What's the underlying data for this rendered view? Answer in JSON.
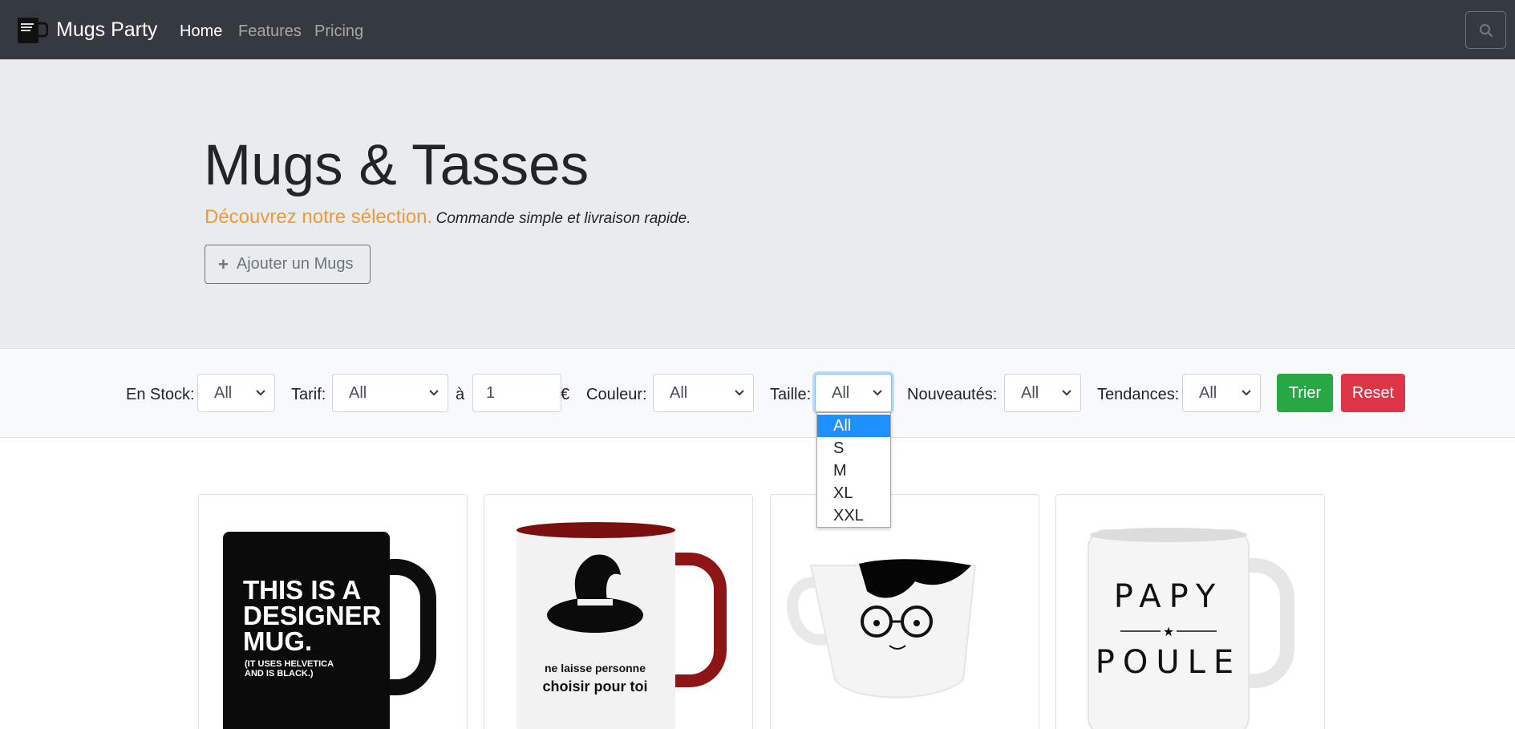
{
  "navbar": {
    "brand": "Mugs Party",
    "links": [
      "Home",
      "Features",
      "Pricing"
    ],
    "active_index": 0,
    "search_icon": "search-icon"
  },
  "hero": {
    "title": "Mugs & Tasses",
    "lead_accent": "Découvrez notre sélection.",
    "lead_sub": "Commande simple et livraison rapide.",
    "add_button": "Ajouter un Mugs",
    "add_icon": "plus-icon"
  },
  "filters": {
    "stock_label": "En Stock:",
    "stock_value": "All",
    "tarif_label": "Tarif:",
    "tarif_value": "All",
    "a_label": "à",
    "max_price_value": "1",
    "currency": "€",
    "couleur_label": "Couleur:",
    "couleur_value": "All",
    "taille_label": "Taille:",
    "taille_value": "All",
    "taille_options": [
      "All",
      "S",
      "M",
      "XL",
      "XXL"
    ],
    "taille_selected": "All",
    "nouveautes_label": "Nouveautés:",
    "nouveautes_value": "All",
    "tendances_label": "Tendances:",
    "tendances_value": "All",
    "sort_button": "Trier",
    "reset_button": "Reset"
  },
  "products": [
    {
      "image_text": [
        "THIS IS A",
        "DESIGNER",
        "MUG.",
        "(IT USES HELVETICA",
        "AND IS BLACK.)"
      ]
    },
    {
      "image_text": [
        "ne laisse personne",
        "choisir pour toi"
      ]
    },
    {
      "image_text": []
    },
    {
      "image_text": [
        "PAPY",
        "POULE"
      ]
    }
  ],
  "colors": {
    "navbar_bg": "#343a40",
    "hero_bg": "#e9ecef",
    "accent_orange": "#f0983a",
    "success_green": "#28a745",
    "danger_red": "#dc3545",
    "option_highlight": "#1e90ff"
  }
}
